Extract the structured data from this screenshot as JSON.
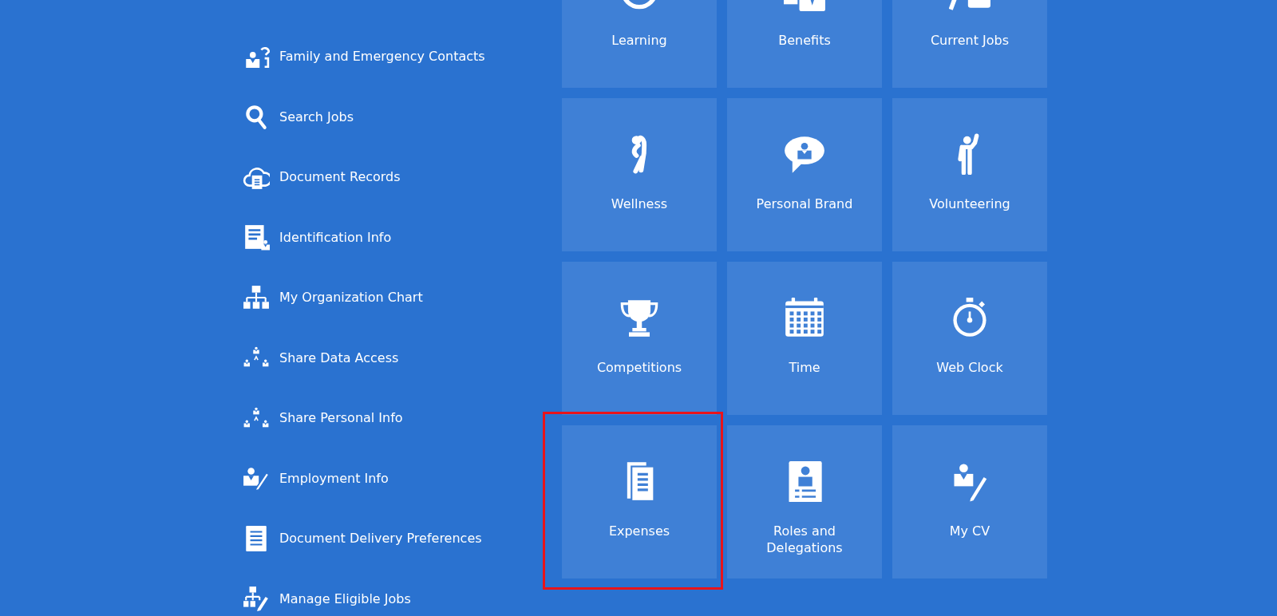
{
  "sidebar": {
    "items": [
      {
        "label": "Family and Emergency Contacts"
      },
      {
        "label": "Search Jobs"
      },
      {
        "label": "Document Records"
      },
      {
        "label": "Identification Info"
      },
      {
        "label": "My Organization Chart"
      },
      {
        "label": "Share Data Access"
      },
      {
        "label": "Share Personal Info"
      },
      {
        "label": "Employment Info"
      },
      {
        "label": "Document Delivery Preferences"
      },
      {
        "label": "Manage Eligible Jobs"
      }
    ]
  },
  "tiles": [
    {
      "label": "Learning",
      "highlighted": false
    },
    {
      "label": "Benefits",
      "highlighted": false
    },
    {
      "label": "Current Jobs",
      "highlighted": false
    },
    {
      "label": "Wellness",
      "highlighted": false
    },
    {
      "label": "Personal Brand",
      "highlighted": false
    },
    {
      "label": "Volunteering",
      "highlighted": false
    },
    {
      "label": "Competitions",
      "highlighted": false
    },
    {
      "label": "Time",
      "highlighted": false
    },
    {
      "label": "Web Clock",
      "highlighted": false
    },
    {
      "label": "Expenses",
      "highlighted": true
    },
    {
      "label": "Roles and Delegations",
      "highlighted": false
    },
    {
      "label": "My CV",
      "highlighted": false
    }
  ]
}
